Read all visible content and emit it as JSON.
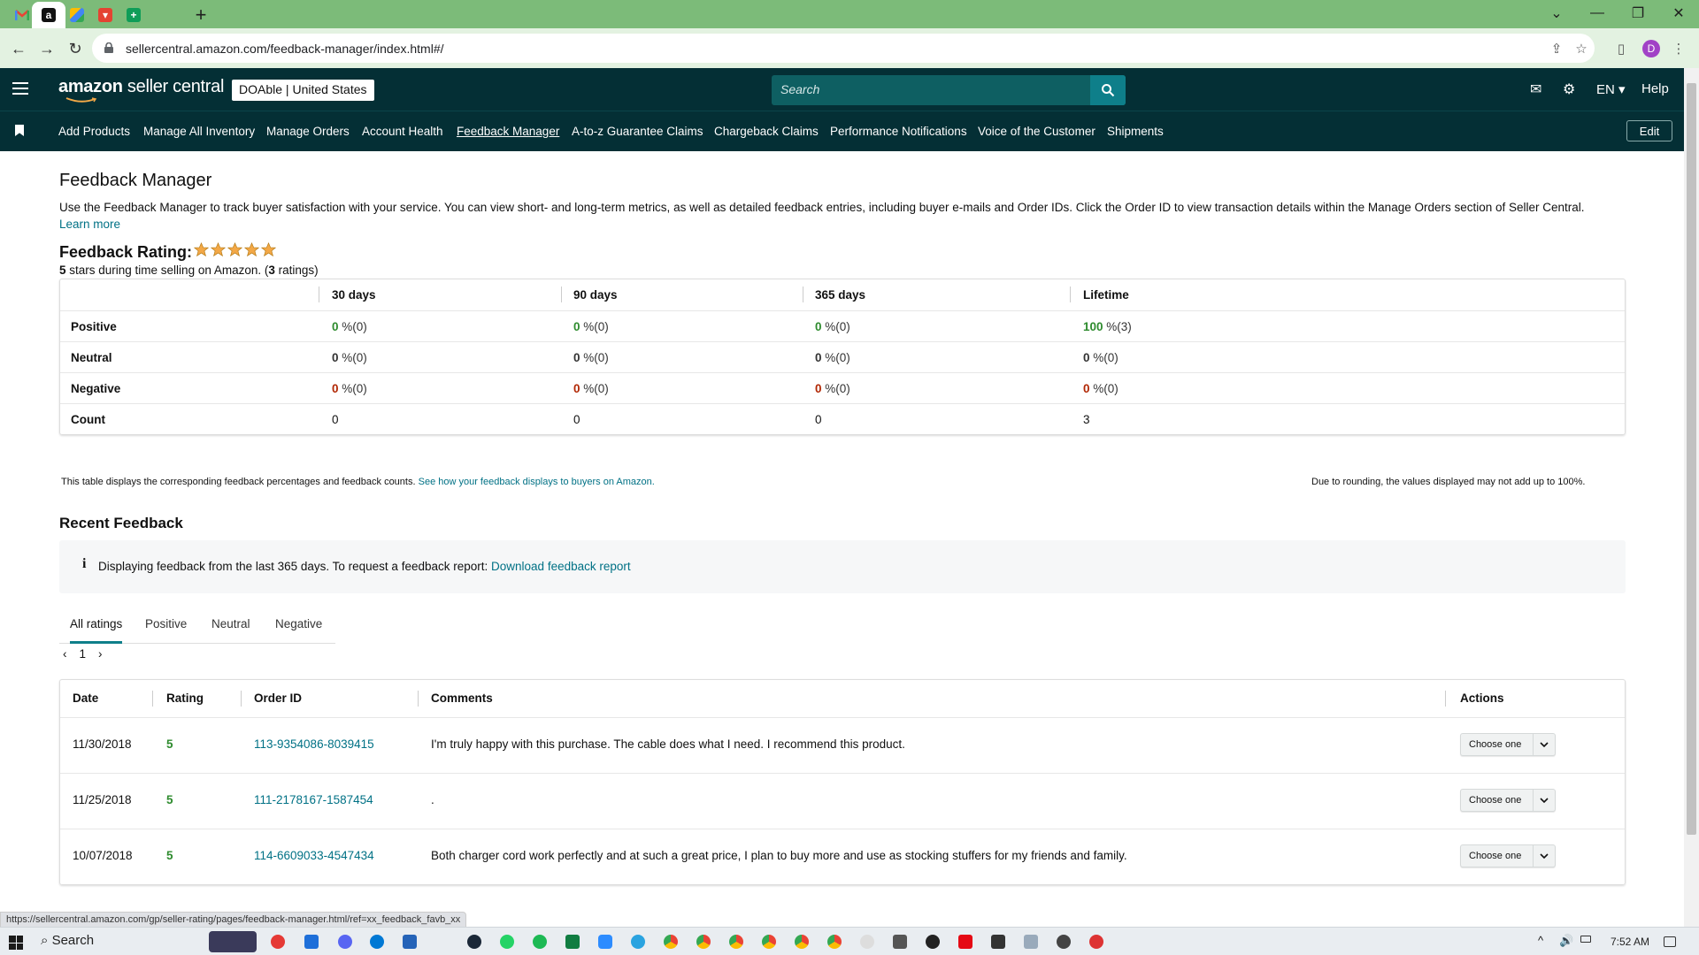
{
  "browser": {
    "url": "sellercentral.amazon.com/feedback-manager/index.html#/",
    "status_url": "https://sellercentral.amazon.com/gp/seller-rating/pages/feedback-manager.html/ref=xx_feedback_favb_xx",
    "profile_initial": "D",
    "tab_icons": [
      "gmail-icon",
      "amazon-icon",
      "drive-icon",
      "todoist-icon",
      "sheets-icon"
    ]
  },
  "topnav": {
    "logo_prefix": "amazon",
    "logo_suffix": " seller central",
    "store_name": "DOAble",
    "store_region": "United States",
    "search_placeholder": "Search",
    "language": "EN",
    "help": "Help"
  },
  "subnav": {
    "items": [
      "Add Products",
      "Manage All Inventory",
      "Manage Orders",
      "Account Health",
      "Feedback Manager",
      "A-to-z Guarantee Claims",
      "Chargeback Claims",
      "Performance Notifications",
      "Voice of the Customer",
      "Shipments"
    ],
    "active": "Feedback Manager",
    "edit": "Edit"
  },
  "page": {
    "title": "Feedback Manager",
    "intro": "Use the Feedback Manager to track buyer satisfaction with your service. You can view short- and long-term metrics, as well as detailed feedback entries, including buyer e-mails and Order IDs. Click the Order ID to view transaction details within the Manage Orders section of Seller Central.",
    "learn_more": "Learn more",
    "rating_label": "Feedback Rating:",
    "stars": 5,
    "rating_stars_value": "5",
    "rating_sub_mid": " stars during time selling on Amazon. (",
    "rating_count": "3",
    "rating_sub_end": " ratings)"
  },
  "feedback_table": {
    "columns": [
      "30 days",
      "90 days",
      "365 days",
      "Lifetime"
    ],
    "rows": [
      {
        "label": "Positive",
        "cells": [
          {
            "v": "0",
            "c": "(0)"
          },
          {
            "v": "0",
            "c": "(0)"
          },
          {
            "v": "0",
            "c": "(0)"
          },
          {
            "v": "100",
            "c": "(3)"
          }
        ]
      },
      {
        "label": "Neutral",
        "cells": [
          {
            "v": "0",
            "c": "(0)"
          },
          {
            "v": "0",
            "c": "(0)"
          },
          {
            "v": "0",
            "c": "(0)"
          },
          {
            "v": "0",
            "c": "(0)"
          }
        ]
      },
      {
        "label": "Negative",
        "cells": [
          {
            "v": "0",
            "c": "(0)"
          },
          {
            "v": "0",
            "c": "(0)"
          },
          {
            "v": "0",
            "c": "(0)"
          },
          {
            "v": "0",
            "c": "(0)"
          }
        ]
      }
    ],
    "count_label": "Count",
    "counts": [
      "0",
      "0",
      "0",
      "3"
    ],
    "percent_sign": " %",
    "note": "This table displays the corresponding feedback percentages and feedback counts.",
    "note_link": "See how your feedback displays to buyers on Amazon.",
    "rounding_note": "Due to rounding, the values displayed may not add up to 100%."
  },
  "recent": {
    "title": "Recent Feedback",
    "info_icon": "i",
    "info": "Displaying feedback from the last 365 days. To request a feedback report:",
    "info_link": "Download feedback report",
    "tabs": [
      "All ratings",
      "Positive",
      "Neutral",
      "Negative"
    ],
    "active_tab": "All ratings",
    "page": "1",
    "columns": [
      "Date",
      "Rating",
      "Order ID",
      "Comments",
      "Actions"
    ],
    "rows": [
      {
        "date": "11/30/2018",
        "rating": "5",
        "order_id": "113-9354086-8039415",
        "comment": "I'm truly happy with this purchase. The cable does what I need. I recommend this product.",
        "action": "Choose one"
      },
      {
        "date": "11/25/2018",
        "rating": "5",
        "order_id": "111-2178167-1587454",
        "comment": ".",
        "action": "Choose one"
      },
      {
        "date": "10/07/2018",
        "rating": "5",
        "order_id": "114-6609033-4547434",
        "comment": "Both charger cord work perfectly and at such a great price, I plan to buy more and use as stocking stuffers for my friends and family.",
        "action": "Choose one"
      }
    ]
  },
  "taskbar": {
    "search": "Search",
    "time": "7:52 AM"
  },
  "colors": {
    "nav_bg": "#042f35",
    "link": "#007185",
    "positive": "#2e8b2e",
    "negative": "#b12704",
    "star": "#f3a847",
    "chrome_frame": "#7cbb79"
  }
}
